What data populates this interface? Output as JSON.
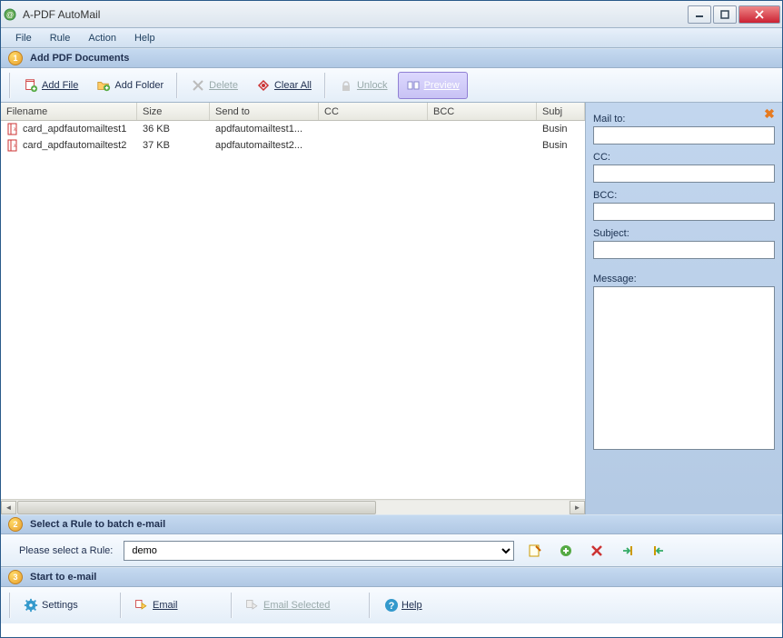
{
  "title": "A-PDF AutoMail",
  "menu": {
    "file": "File",
    "rule": "Rule",
    "action": "Action",
    "help": "Help"
  },
  "sections": {
    "s1": {
      "num": "1",
      "title": "Add PDF Documents"
    },
    "s2": {
      "num": "2",
      "title": "Select a Rule to batch e-mail"
    },
    "s3": {
      "num": "3",
      "title": "Start to e-mail"
    }
  },
  "toolbar": {
    "addfile": "Add File",
    "addfolder": "Add Folder",
    "delete": "Delete",
    "clearall": "Clear All",
    "unlock": "Unlock",
    "preview": "Preview"
  },
  "columns": {
    "filename": "Filename",
    "size": "Size",
    "sendto": "Send to",
    "cc": "CC",
    "bcc": "BCC",
    "subj": "Subj"
  },
  "rows": [
    {
      "filename": "card_apdfautomailtest1",
      "size": "36 KB",
      "sendto": "apdfautomailtest1...",
      "cc": "",
      "bcc": "",
      "subj": "Busin"
    },
    {
      "filename": "card_apdfautomailtest2",
      "size": "37 KB",
      "sendto": "apdfautomailtest2...",
      "cc": "",
      "bcc": "",
      "subj": "Busin"
    }
  ],
  "sidepanel": {
    "mailto": "Mail to:",
    "cc": "CC:",
    "bcc": "BCC:",
    "subject": "Subject:",
    "message": "Message:"
  },
  "rule": {
    "label": "Please select a Rule:",
    "selected": "demo",
    "options": [
      "demo"
    ]
  },
  "bottom": {
    "settings": "Settings",
    "email": "Email",
    "emailsel": "Email Selected",
    "help": "Help"
  }
}
